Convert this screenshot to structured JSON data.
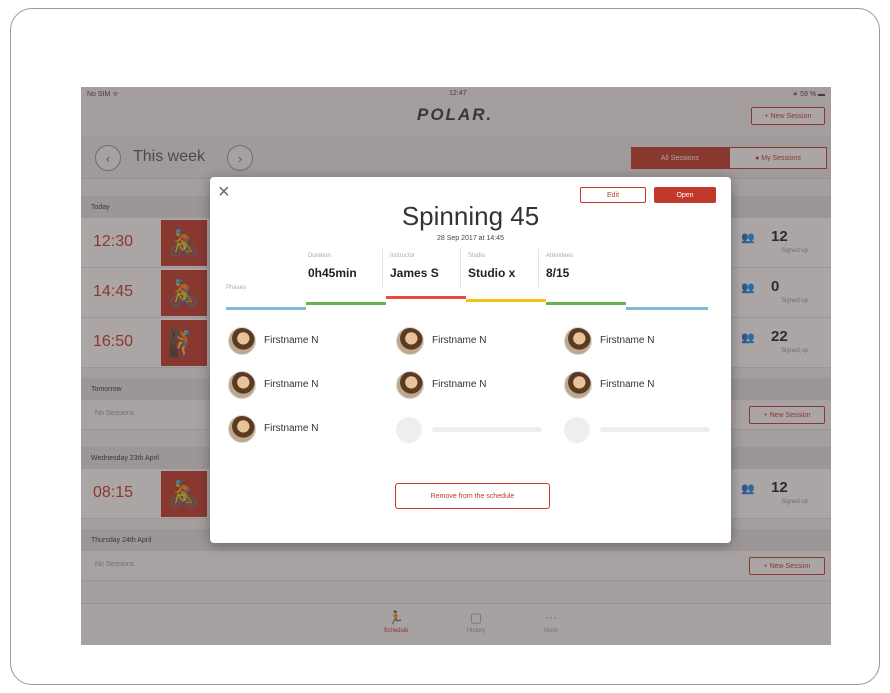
{
  "status_bar": {
    "carrier": "No SIM ᯤ",
    "time": "12:47",
    "battery": "∗ 59 % ▬"
  },
  "header": {
    "logo": "POLAR.",
    "new_session_label": "+ New Session"
  },
  "nav": {
    "week_label": "This week",
    "prev_icon": "‹",
    "next_icon": "›",
    "all_sessions": "All Sessions",
    "my_sessions": "● My Sessions"
  },
  "schedule": {
    "today": "Today",
    "rows": [
      {
        "time": "12:30",
        "icon": "cycling-icon",
        "count": "12",
        "count_label": "Signed up"
      },
      {
        "time": "14:45",
        "icon": "cycling-icon",
        "count": "0",
        "count_label": "Signed up"
      },
      {
        "time": "16:50",
        "icon": "climbing-icon",
        "count": "22",
        "count_label": "Signed up"
      }
    ],
    "tomorrow": "Tomorrow",
    "tomorrow_empty": "No Sessions",
    "tomorrow_new": "+ New Session",
    "wednesday": "Wednesday 23th April",
    "wed_row": {
      "time": "08:15",
      "icon": "cycling-icon",
      "count": "12",
      "count_label": "Signed up"
    },
    "thursday": "Thursday 24th April",
    "thursday_empty": "No Sessions",
    "thursday_new": "+ New Session"
  },
  "tabs": [
    {
      "label": "Schedule",
      "icon": "runner-icon"
    },
    {
      "label": "History",
      "icon": "calendar-icon"
    },
    {
      "label": "More",
      "icon": "more-icon"
    }
  ],
  "modal": {
    "close": "×",
    "edit_label": "Edit",
    "open_label": "Open",
    "title": "Spinning 45",
    "date": "28 Sep 2017 at 14:45",
    "phases_label": "Phases",
    "stats": [
      {
        "label": "Duration",
        "value": "0h45min"
      },
      {
        "label": "Instructor",
        "value": "James S"
      },
      {
        "label": "Studio",
        "value": "Studio x"
      },
      {
        "label": "Attendees",
        "value": "8/15"
      }
    ],
    "phase_colors": [
      "#7fbcd2",
      "#6ab04c",
      "#e74c3c",
      "#f1c40f",
      "#6ab04c",
      "#7fbcd2"
    ],
    "attendees": [
      "Firstname N",
      "Firstname N",
      "Firstname N",
      "Firstname N",
      "Firstname N",
      "Firstname N",
      "Firstname N"
    ],
    "remove_label": "Remove from the schedule"
  },
  "colors": {
    "accent": "#c0392b"
  }
}
